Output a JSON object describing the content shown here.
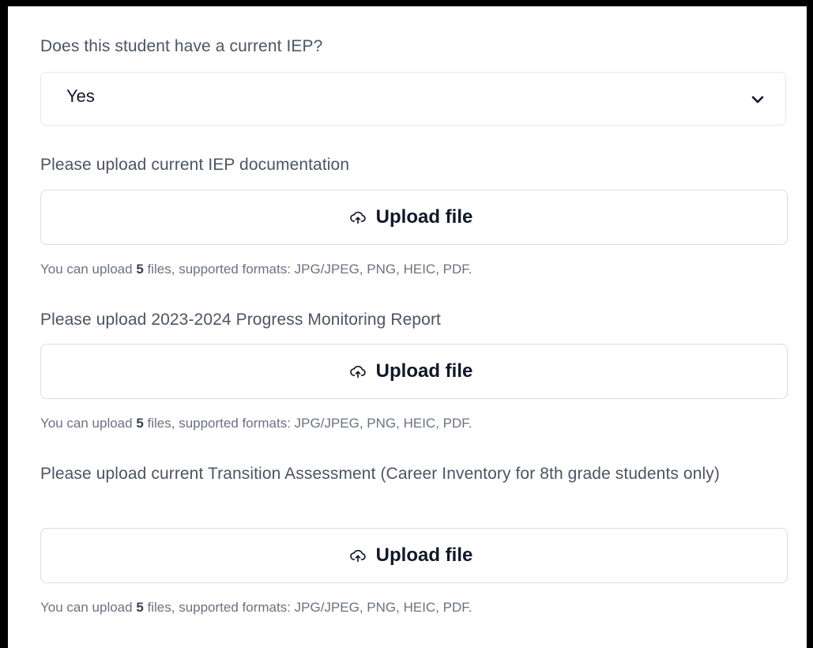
{
  "questions": {
    "iep_question": "Does this student have a current IEP?",
    "iep_answer": "Yes"
  },
  "uploads": [
    {
      "label": "Please upload current IEP documentation",
      "button_label": "Upload file",
      "hint_prefix": "You can upload ",
      "hint_count": "5",
      "hint_suffix": " files, supported formats: JPG/JPEG, PNG, HEIC, PDF."
    },
    {
      "label": "Please upload 2023-2024 Progress Monitoring Report",
      "button_label": "Upload file",
      "hint_prefix": "You can upload ",
      "hint_count": "5",
      "hint_suffix": " files, supported formats: JPG/JPEG, PNG, HEIC, PDF."
    },
    {
      "label": "Please upload current Transition Assessment (Career Inventory for 8th grade students only)",
      "button_label": "Upload file",
      "hint_prefix": "You can upload ",
      "hint_count": "5",
      "hint_suffix": " files, supported formats: JPG/JPEG, PNG, HEIC, PDF."
    }
  ],
  "icons": {
    "select": "chevron-down-icon",
    "upload": "cloud-upload-icon"
  },
  "colors": {
    "text": "#111827",
    "label": "#4b5563",
    "hint": "#6b7280",
    "border": "#d9dde3"
  }
}
